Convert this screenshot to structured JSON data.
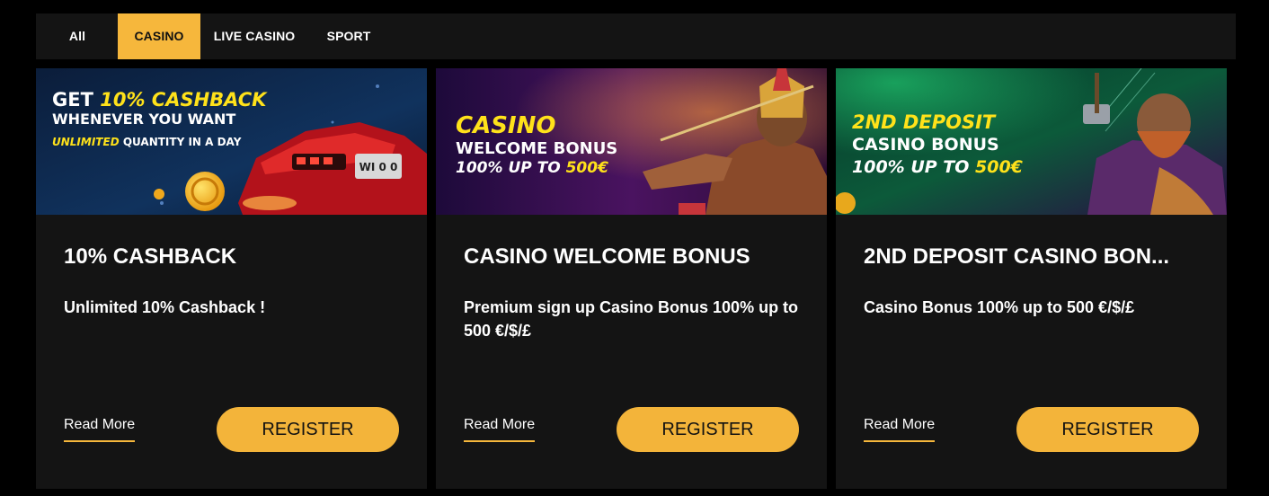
{
  "tabs": [
    {
      "label": "All"
    },
    {
      "label": "CASINO"
    },
    {
      "label": "LIVE CASINO"
    },
    {
      "label": "SPORT"
    }
  ],
  "colors": {
    "accent": "#f6b73c",
    "card_bg": "#141414",
    "page_bg": "#000000"
  },
  "cards": [
    {
      "banner": {
        "line1_prefix": "GET ",
        "line1_highlight": "10% CASHBACK",
        "line2": "WHENEVER YOU WANT",
        "line3_highlight": "UNLIMITED",
        "line3_rest": " QUANTITY IN A DAY",
        "plate": "WI 0 0"
      },
      "title": "10% CASHBACK",
      "description": "Unlimited 10% Cashback !",
      "read_more": "Read More",
      "register": "REGISTER"
    },
    {
      "banner": {
        "line1": "CASINO",
        "line2": "WELCOME BONUS",
        "line3_prefix": "100% UP TO ",
        "line3_highlight": "500€"
      },
      "title": "CASINO WELCOME BONUS",
      "description": "Premium sign up Casino Bonus 100% up to 500 €/$/£",
      "read_more": "Read More",
      "register": "REGISTER"
    },
    {
      "banner": {
        "line1": "2ND  DEPOSIT",
        "line2": "CASINO BONUS",
        "line3_prefix": "100% UP TO ",
        "line3_highlight": "500€"
      },
      "title": "2ND DEPOSIT CASINO BON...",
      "description": "Casino Bonus 100% up to 500 €/$/£",
      "read_more": "Read More",
      "register": "REGISTER"
    }
  ]
}
